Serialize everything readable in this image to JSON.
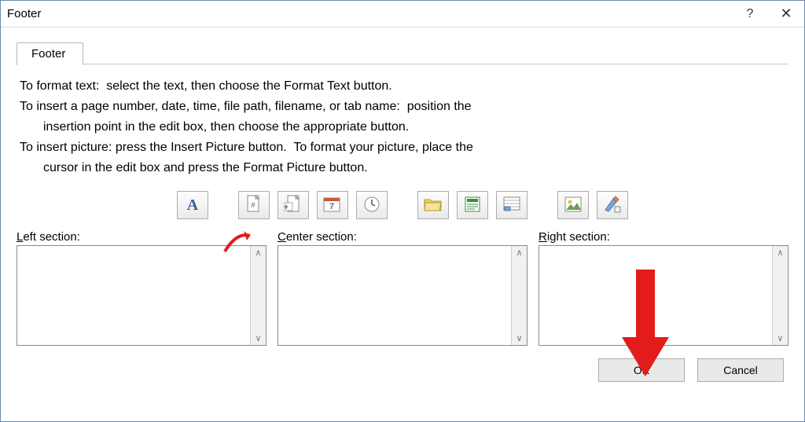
{
  "window": {
    "title": "Footer",
    "help_symbol": "?",
    "close_symbol": "✕"
  },
  "tab": {
    "label": "Footer"
  },
  "instructions": {
    "line1a": "To format text:  select the text, then choose the Format Text button.",
    "line2a": "To insert a page number, date, time, file path, filename, or tab name:  position the",
    "line2b": "insertion point in the edit box, then choose the appropriate button.",
    "line3a": "To insert picture: press the Insert Picture button.  To format your picture, place the",
    "line3b": "cursor in the edit box and press the Format Picture button."
  },
  "toolbar": {
    "format_text": "A",
    "page_number": "page-number-icon",
    "pages": "number-of-pages-icon",
    "date": "date-icon",
    "time": "time-icon",
    "filepath": "file-path-icon",
    "filename": "file-name-icon",
    "sheet": "sheet-name-icon",
    "picture": "insert-picture-icon",
    "format_picture": "format-picture-icon"
  },
  "sections": {
    "left_label_u": "L",
    "left_label_rest": "eft section:",
    "center_label_u": "C",
    "center_label_rest": "enter section:",
    "right_label_u": "R",
    "right_label_rest": "ight section:",
    "left_value": "",
    "center_value": "",
    "right_value": ""
  },
  "buttons": {
    "ok": "OK",
    "cancel": "Cancel"
  }
}
